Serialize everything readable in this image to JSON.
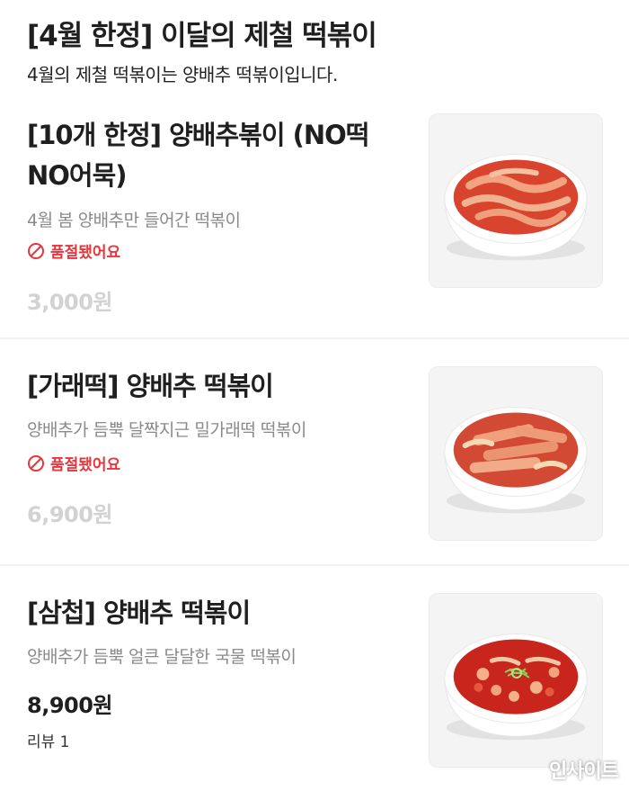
{
  "section": {
    "title": "[4월 한정] 이달의 제철 떡볶이",
    "description": "4월의 제철 떡볶이는 양배추 떡볶이입니다."
  },
  "items": [
    {
      "name_line1": "[10개 한정] 양배추볶이 (NO떡",
      "name_line2": "NO어묵)",
      "description": "4월 봄 양배추만 들어간 떡볶이",
      "status": "품절됐어요",
      "price": "3,000원",
      "image": "cabbage-tteokbokki-bowl"
    },
    {
      "name": "[가래떡] 양배추 떡볶이",
      "description": "양배추가 듬뿍 달짝지근 밀가래떡 떡볶이",
      "status": "품절됐어요",
      "price": "6,900원",
      "image": "garaetteok-tteokbokki-bowl"
    },
    {
      "name": "[삼첩] 양배추 떡볶이",
      "description": "양배추가 듬뿍 얼큰 달달한 국물 떡볶이",
      "price": "8,900원",
      "review": "리뷰 1",
      "image": "soup-tteokbokki-bowl"
    }
  ],
  "icons": {
    "soldout": "prohibited-icon"
  },
  "colors": {
    "soldout": "#e8363d",
    "price_disabled": "#d2d2d2",
    "description": "#8a8a8a",
    "sauce": "#d9442f"
  },
  "watermark": "인사이트"
}
